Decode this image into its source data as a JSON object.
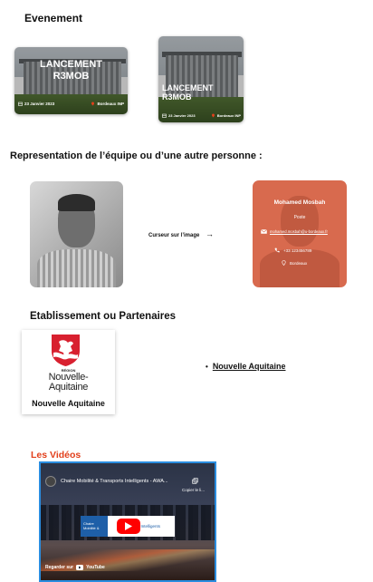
{
  "events": {
    "heading": "Evenement",
    "cards": [
      {
        "title": "LANCEMENT R3MOB",
        "date": "23 Janvier 2023",
        "location": "Bordeaux INP"
      },
      {
        "title": "LANCEMENT R3MOB",
        "date": "23 Janvier 2023",
        "location": "Bordeaux INP"
      }
    ]
  },
  "team": {
    "heading": "Representation de l’équipe ou d’une autre personne :",
    "hover_hint": "Curseur sur l’image",
    "arrow": "→",
    "person": {
      "name": "Mohamed Mosbah",
      "role": "Poste",
      "email": "mohamed.mosbah@u-bordeaux.fr",
      "phone": "+33 123456789",
      "city": "Bordeaux"
    }
  },
  "partners": {
    "heading": "Etablissement ou Partenaires",
    "logo_region": "RÉGION",
    "logo_line1": "Nouvelle-",
    "logo_line2": "Aquitaine",
    "caption": "Nouvelle Aquitaine",
    "list": [
      "Nouvelle Aquitaine"
    ]
  },
  "videos": {
    "heading": "Les Vidéos",
    "video_title": "Chaire Mobilité & Transports Intelligents - AWA...",
    "copy_label": "Copier le li...",
    "banner_left": "Chaire",
    "banner_left2": "Mobilité &",
    "banner_right": "s Intelligents",
    "watch_on": "Regarder sur",
    "youtube": "YouTube",
    "accent": "#2a8de0",
    "heading_color": "#e2401c"
  }
}
